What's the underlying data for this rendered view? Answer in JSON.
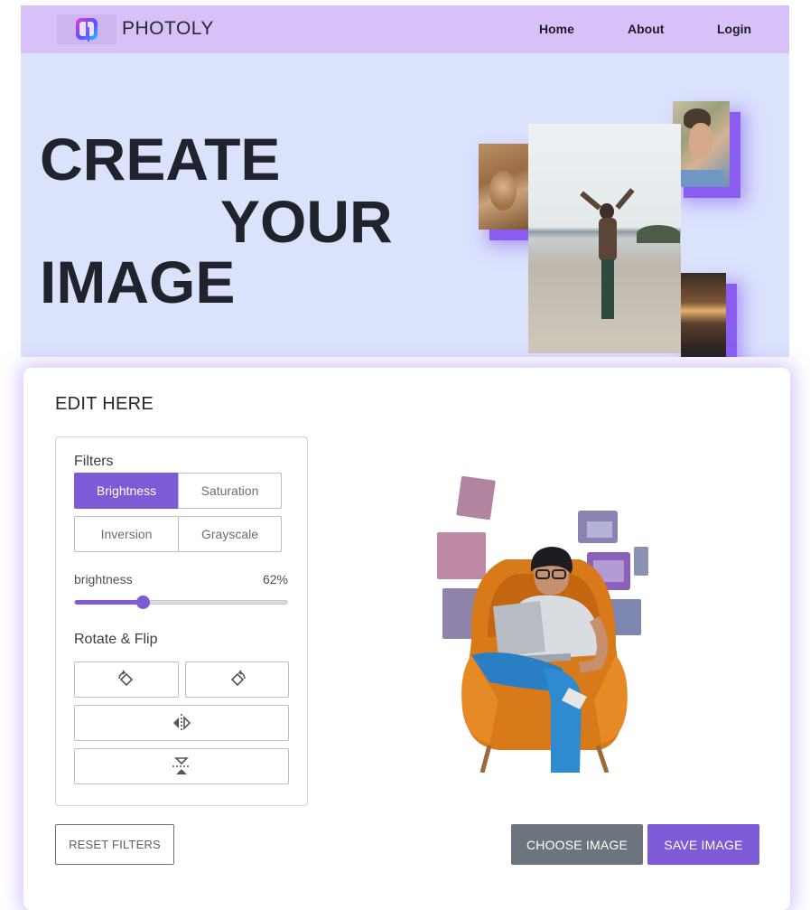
{
  "nav": {
    "brand": "PHOTOLY",
    "links": [
      "Home",
      "About",
      "Login"
    ]
  },
  "hero": {
    "lines": [
      "CREATE",
      "YOUR",
      "IMAGE"
    ]
  },
  "editor": {
    "title": "EDIT HERE",
    "filters_label": "Filters",
    "filters": [
      "Brightness",
      "Saturation",
      "Inversion",
      "Grayscale"
    ],
    "active_filter": "Brightness",
    "slider": {
      "name": "brightness",
      "value_text": "62%",
      "value": 0.32
    },
    "rotate_flip_label": "Rotate & Flip",
    "rotate_icons": [
      "rotate-left-icon",
      "rotate-right-icon",
      "flip-horizontal-icon",
      "flip-vertical-icon"
    ],
    "buttons": {
      "reset": "RESET FILTERS",
      "choose": "CHOOSE IMAGE",
      "save": "SAVE IMAGE"
    }
  },
  "colors": {
    "nav_bg": "#d7c1f8",
    "hero_bg": "#dbe2fc",
    "accent": "#7d5ad6",
    "secondary": "#6c757d"
  }
}
